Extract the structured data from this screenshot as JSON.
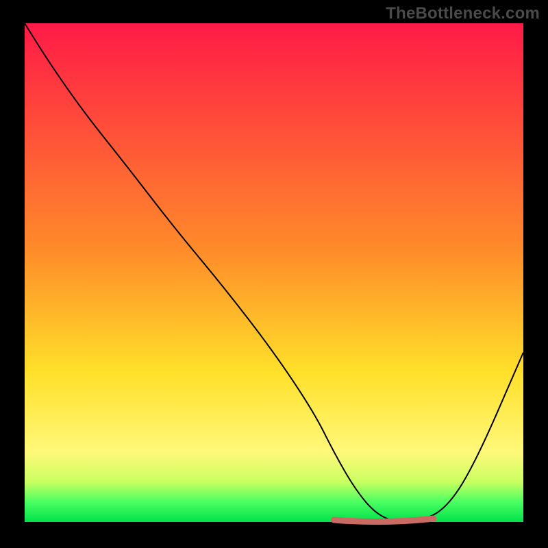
{
  "watermark": "TheBottleneck.com",
  "chart_data": {
    "type": "line",
    "title": "",
    "xlabel": "",
    "ylabel": "",
    "xlim": [
      0,
      100
    ],
    "ylim": [
      0,
      100
    ],
    "grid": false,
    "legend": false,
    "series": [
      {
        "name": "curve",
        "x": [
          0,
          5,
          12,
          20,
          30,
          40,
          50,
          58,
          62,
          66,
          70,
          74,
          78,
          84,
          90,
          100
        ],
        "y": [
          100,
          92,
          82,
          72,
          59,
          47,
          34,
          22,
          14,
          7,
          2,
          0,
          0,
          2,
          11,
          34
        ]
      }
    ],
    "trough_marker": {
      "x_start": 62,
      "x_end": 82,
      "y": 0,
      "color": "#c96a63",
      "thickness": 9,
      "cap": "round"
    },
    "background_gradient": {
      "stops": [
        {
          "offset": 0,
          "color": "#ff1a47"
        },
        {
          "offset": 45,
          "color": "#ff8a2a"
        },
        {
          "offset": 70,
          "color": "#ffe02a"
        },
        {
          "offset": 86,
          "color": "#fff87a"
        },
        {
          "offset": 92,
          "color": "#c8ff60"
        },
        {
          "offset": 96,
          "color": "#4aff62"
        },
        {
          "offset": 100,
          "color": "#00e24a"
        }
      ]
    },
    "curve_color": "#000000",
    "curve_width": 2
  }
}
